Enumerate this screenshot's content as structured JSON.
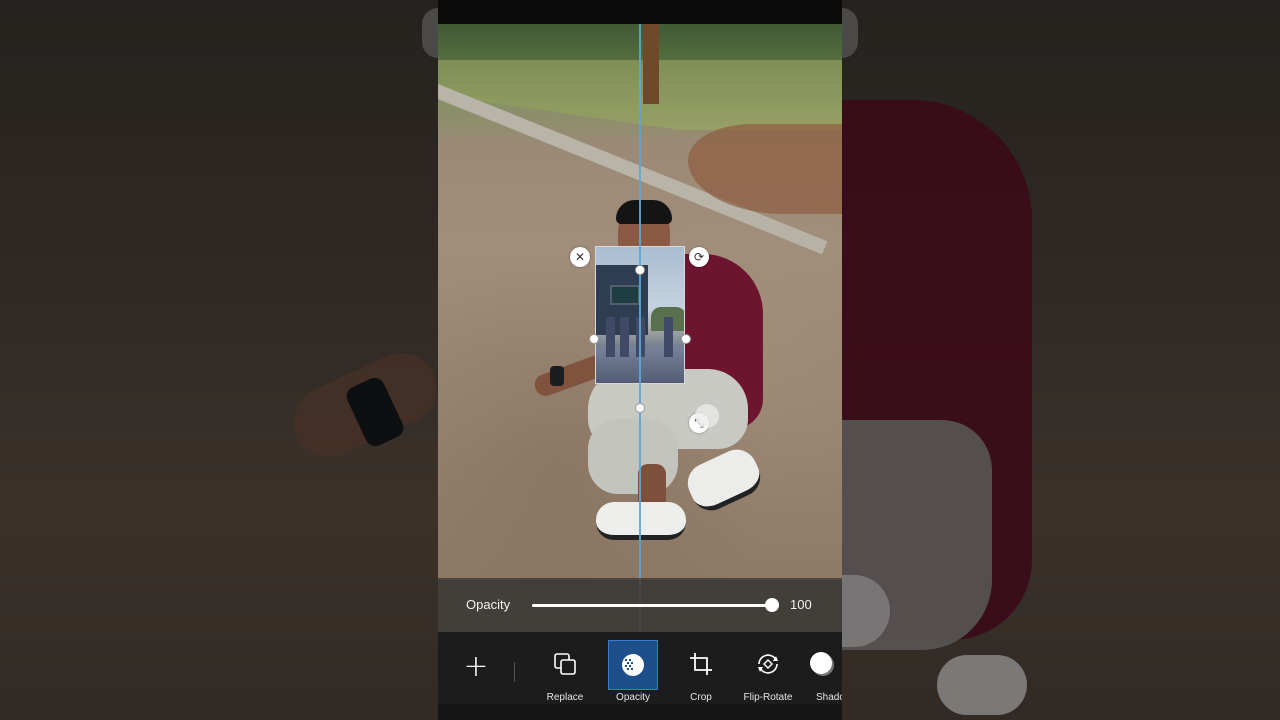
{
  "opacity": {
    "label": "Opacity",
    "value": "100",
    "fraction": 1.0
  },
  "toolbar": {
    "add_label": "+",
    "tools": [
      {
        "label": "Replace",
        "icon": "replace-icon"
      },
      {
        "label": "Opacity",
        "icon": "opacity-icon",
        "active": true
      },
      {
        "label": "Crop",
        "icon": "crop-icon"
      },
      {
        "label": "Flip-Rotate",
        "icon": "flip-rotate-icon"
      },
      {
        "label": "Shadow",
        "icon": "shadow-icon"
      }
    ]
  },
  "sticker_controls": {
    "close_glyph": "✕",
    "rotate_glyph": "⟳",
    "resize_glyph": "⤡"
  },
  "colors": {
    "accent": "#1d4f8a",
    "guide_line": "#5aa7d6",
    "toolbar_bg": "#1c1c1c"
  }
}
